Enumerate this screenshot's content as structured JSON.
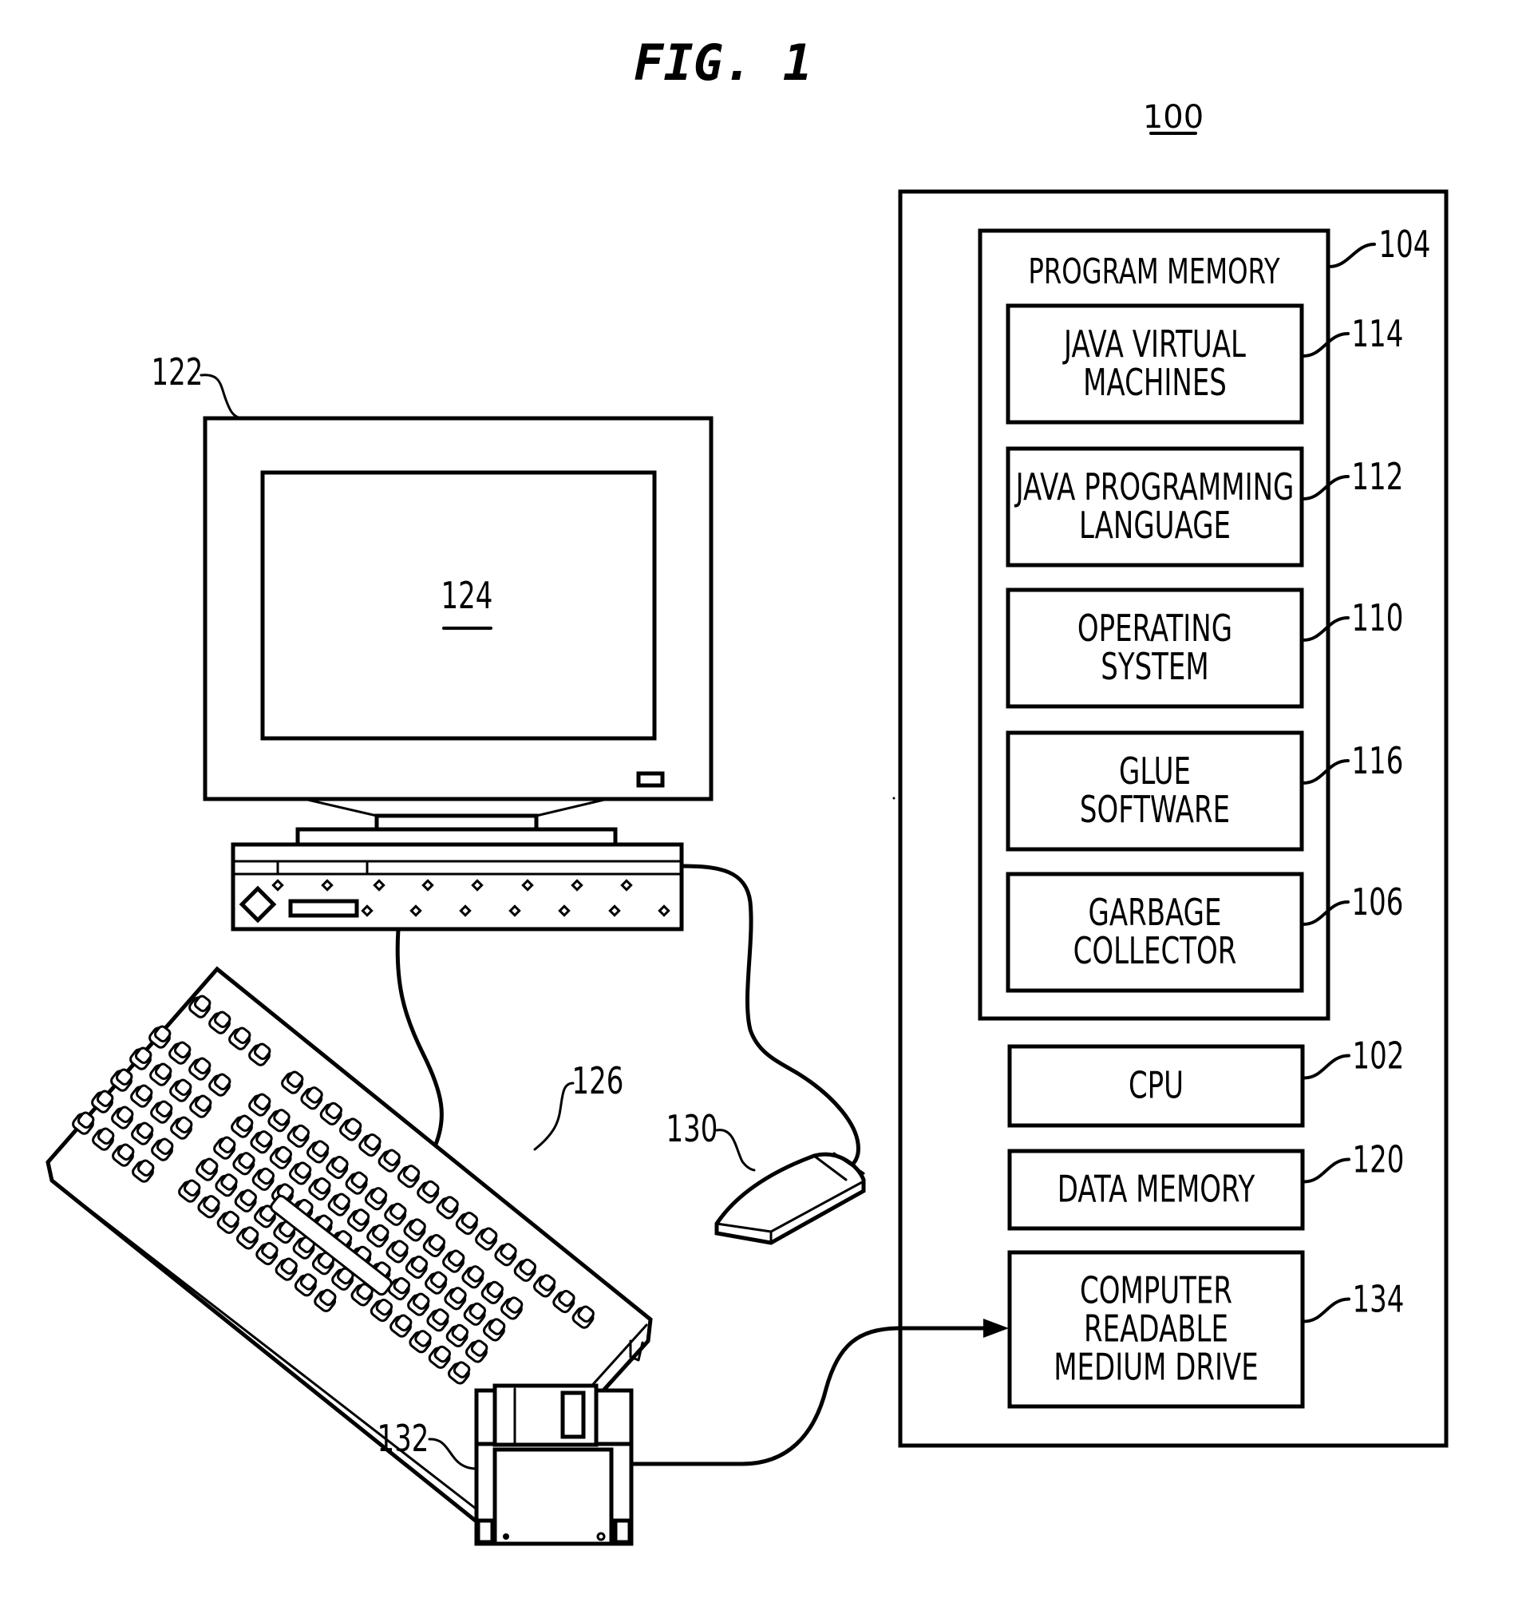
{
  "figure": {
    "title": "FIG. 1",
    "system_ref": "100"
  },
  "system_box": {
    "program_memory": {
      "label": "PROGRAM MEMORY",
      "ref": "104",
      "modules": [
        {
          "lines": [
            "JAVA VIRTUAL",
            "MACHINES"
          ],
          "ref": "114"
        },
        {
          "lines": [
            "JAVA PROGRAMMING",
            "LANGUAGE"
          ],
          "ref": "112"
        },
        {
          "lines": [
            "OPERATING",
            "SYSTEM"
          ],
          "ref": "110"
        },
        {
          "lines": [
            "GLUE",
            "SOFTWARE"
          ],
          "ref": "116"
        },
        {
          "lines": [
            "GARBAGE",
            "COLLECTOR"
          ],
          "ref": "106"
        }
      ]
    },
    "cpu": {
      "lines": [
        "CPU"
      ],
      "ref": "102"
    },
    "data_memory": {
      "lines": [
        "DATA MEMORY"
      ],
      "ref": "120"
    },
    "medium_drive": {
      "lines": [
        "COMPUTER",
        "READABLE",
        "MEDIUM DRIVE"
      ],
      "ref": "134"
    }
  },
  "peripherals": {
    "monitor": {
      "ref": "122",
      "screen_ref": "124"
    },
    "keyboard": {
      "ref": "126"
    },
    "mouse": {
      "ref": "130"
    },
    "floppy_disk": {
      "ref": "132"
    }
  }
}
